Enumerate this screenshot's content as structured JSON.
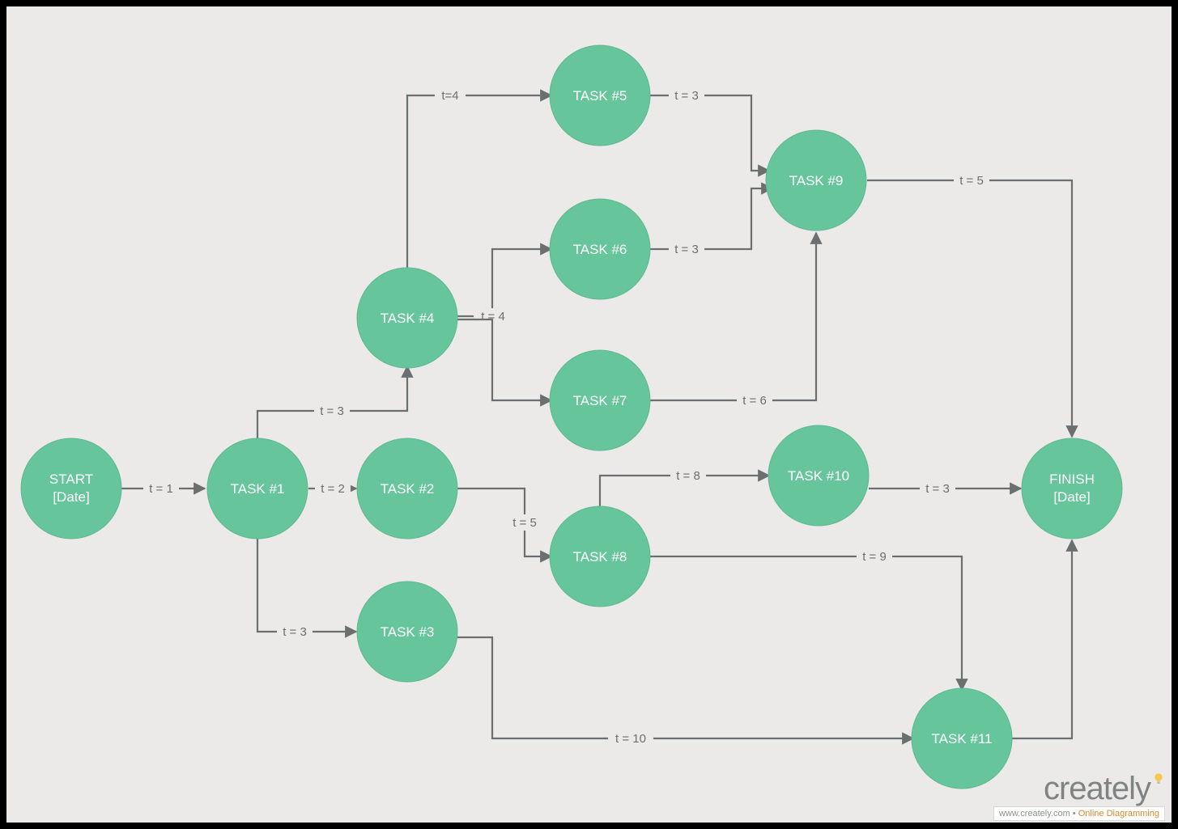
{
  "diagram": {
    "type": "pert-chart",
    "nodes": {
      "start": {
        "label_line1": "START",
        "label_line2": "[Date]"
      },
      "task1": {
        "label": "TASK #1"
      },
      "task2": {
        "label": "TASK #2"
      },
      "task3": {
        "label": "TASK #3"
      },
      "task4": {
        "label": "TASK #4"
      },
      "task5": {
        "label": "TASK #5"
      },
      "task6": {
        "label": "TASK #6"
      },
      "task7": {
        "label": "TASK #7"
      },
      "task8": {
        "label": "TASK #8"
      },
      "task9": {
        "label": "TASK #9"
      },
      "task10": {
        "label": "TASK #10"
      },
      "task11": {
        "label": "TASK #11"
      },
      "finish": {
        "label_line1": "FINISH",
        "label_line2": "[Date]"
      }
    },
    "edges": {
      "start_task1": {
        "label": "t = 1"
      },
      "task1_task4": {
        "label": "t = 3"
      },
      "task1_task2": {
        "label": "t = 2"
      },
      "task1_task3": {
        "label": "t = 3"
      },
      "task4_task5": {
        "label": "t=4"
      },
      "task4_task6": {
        "label": "t = 4"
      },
      "task4_task7": {
        "label": ""
      },
      "task5_task9": {
        "label": "t = 3"
      },
      "task6_task9": {
        "label": "t = 3"
      },
      "task7_task9": {
        "label": "t = 6"
      },
      "task9_finish": {
        "label": "t = 5"
      },
      "task2_task8": {
        "label": "t = 5"
      },
      "task8_task10": {
        "label": "t = 8"
      },
      "task8_task11": {
        "label": "t = 9"
      },
      "task10_finish": {
        "label": "t = 3"
      },
      "task3_task11": {
        "label": "t = 10"
      },
      "task11_finish": {
        "label": ""
      }
    }
  },
  "branding": {
    "logo_text": "creately",
    "url": "www.creately.com",
    "tagline": "Online Diagramming"
  }
}
